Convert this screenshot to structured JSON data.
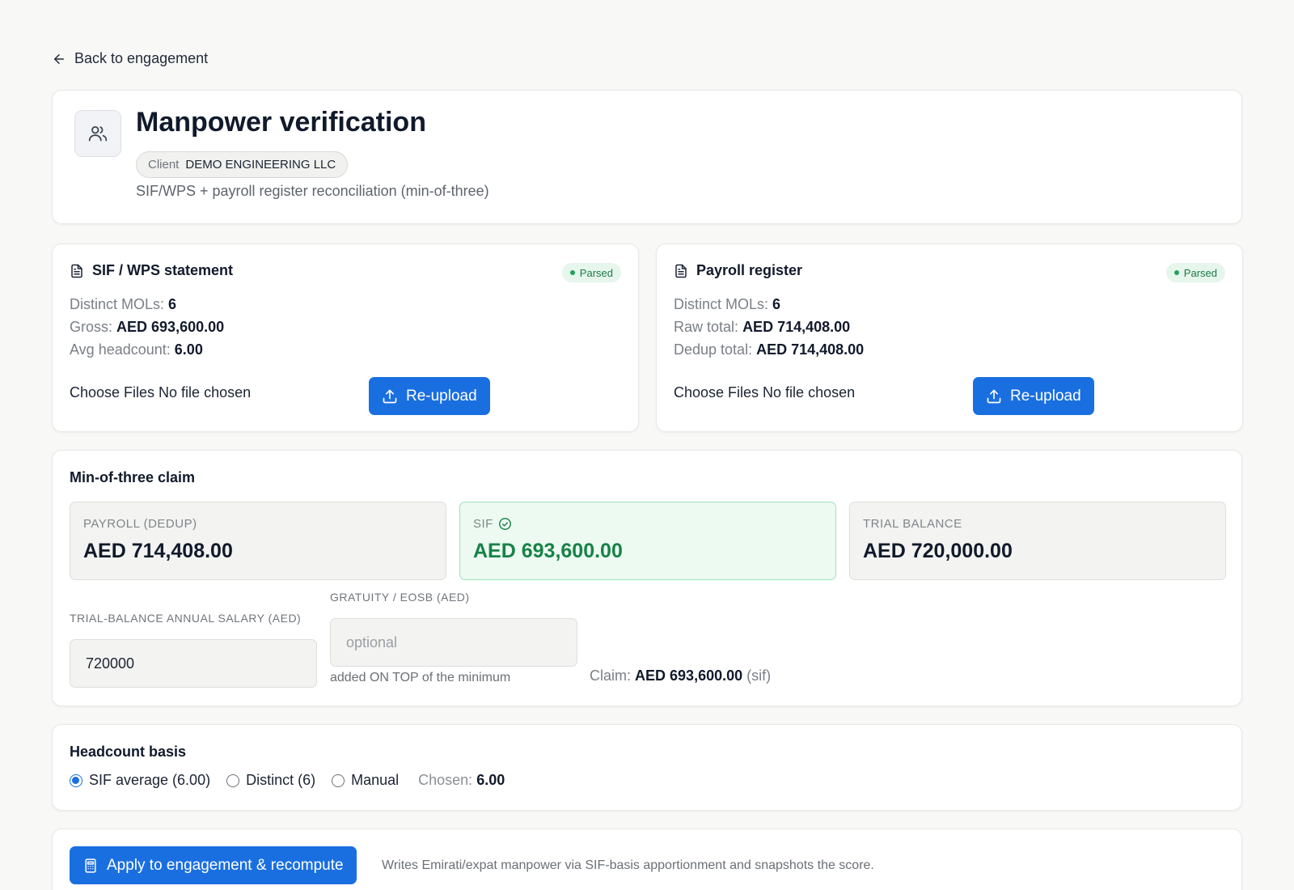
{
  "nav": {
    "back_label": "Back to engagement"
  },
  "header": {
    "title": "Manpower verification",
    "client_label": "Client",
    "client_name": "DEMO ENGINEERING LLC",
    "subtitle": "SIF/WPS + payroll register reconciliation (min-of-three)"
  },
  "sif_card": {
    "title": "SIF / WPS statement",
    "badge": "Parsed",
    "stats": [
      {
        "label": "Distinct MOLs:",
        "value": "6"
      },
      {
        "label": "Gross:",
        "value": "AED 693,600.00"
      },
      {
        "label": "Avg headcount:",
        "value": "6.00"
      }
    ],
    "file_text": "Choose Files No file chosen",
    "button": "Re-upload"
  },
  "payroll_card": {
    "title": "Payroll register",
    "badge": "Parsed",
    "stats": [
      {
        "label": "Distinct MOLs:",
        "value": "6"
      },
      {
        "label": "Raw total:",
        "value": "AED 714,408.00"
      },
      {
        "label": "Dedup total:",
        "value": "AED 714,408.00"
      }
    ],
    "file_text": "Choose Files No file chosen",
    "button": "Re-upload"
  },
  "min_of_three": {
    "title": "Min-of-three claim",
    "tiles": [
      {
        "label": "PAYROLL (DEDUP)",
        "value": "AED 714,408.00"
      },
      {
        "label": "SIF",
        "value": "AED 693,600.00",
        "selected": true
      },
      {
        "label": "TRIAL BALANCE",
        "value": "AED 720,000.00"
      }
    ],
    "tb_label": "TRIAL-BALANCE ANNUAL SALARY (AED)",
    "tb_value": "720000",
    "gratuity_label": "GRATUITY / EOSB (AED)",
    "gratuity_placeholder": "optional",
    "gratuity_hint": "added ON TOP of the minimum",
    "claim_label": "Claim:",
    "claim_value": "AED 693,600.00",
    "claim_basis": "(sif)"
  },
  "headcount": {
    "title": "Headcount basis",
    "options": [
      {
        "label": "SIF average (6.00)",
        "selected": true
      },
      {
        "label": "Distinct (6)",
        "selected": false
      },
      {
        "label": "Manual",
        "selected": false
      }
    ],
    "chosen_label": "Chosen:",
    "chosen_value": "6.00"
  },
  "apply": {
    "button": "Apply to engagement & recompute",
    "note": "Writes Emirati/expat manpower via SIF-basis apportionment and snapshots the score."
  },
  "colors": {
    "accent": "#1a6fe0",
    "success": "#188246",
    "success_bg": "#ecfaf2"
  }
}
